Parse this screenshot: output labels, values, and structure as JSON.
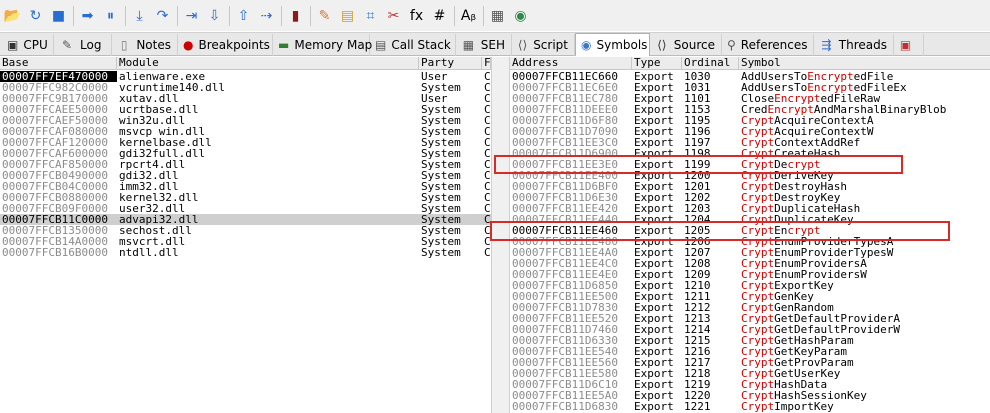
{
  "toolbar": {
    "buttons": [
      {
        "name": "open-icon",
        "glyph": "📂",
        "color": "#d8a437"
      },
      {
        "name": "restart-icon",
        "glyph": "↻",
        "color": "#2a6dd1"
      },
      {
        "name": "stop-icon",
        "glyph": "■",
        "color": "#2a6dd1"
      },
      {
        "name": "sep"
      },
      {
        "name": "run-icon",
        "glyph": "➡",
        "color": "#2a6dd1"
      },
      {
        "name": "pause-icon",
        "glyph": "⏸",
        "color": "#2a6dd1"
      },
      {
        "name": "sep"
      },
      {
        "name": "step-into-icon",
        "glyph": "⤓",
        "color": "#2a6dd1"
      },
      {
        "name": "step-over-icon",
        "glyph": "↷",
        "color": "#2a6dd1"
      },
      {
        "name": "sep"
      },
      {
        "name": "trace-into-icon",
        "glyph": "⇥",
        "color": "#2a6dd1"
      },
      {
        "name": "trace-over-icon",
        "glyph": "⇩",
        "color": "#2a6dd1"
      },
      {
        "name": "sep"
      },
      {
        "name": "execute-till-return-icon",
        "glyph": "⇧",
        "color": "#2a6dd1"
      },
      {
        "name": "run-to-user-code-icon",
        "glyph": "⇢",
        "color": "#2a6dd1"
      },
      {
        "name": "sep"
      },
      {
        "name": "scylla-icon",
        "glyph": "▮",
        "color": "#8a1a1a"
      },
      {
        "name": "sep"
      },
      {
        "name": "patches-icon",
        "glyph": "✎",
        "color": "#d87a3a"
      },
      {
        "name": "comments-icon",
        "glyph": "▤",
        "color": "#c9a227"
      },
      {
        "name": "labels-icon",
        "glyph": "⌗",
        "color": "#3a78c8"
      },
      {
        "name": "bookmarks-icon",
        "glyph": "✂",
        "color": "#c03030"
      },
      {
        "name": "functions-icon",
        "glyph": "fx",
        "color": "#000000"
      },
      {
        "name": "variables-icon",
        "glyph": "#",
        "color": "#000000"
      },
      {
        "name": "sep"
      },
      {
        "name": "strings-icon",
        "glyph": "Aᵦ",
        "color": "#000000"
      },
      {
        "name": "sep"
      },
      {
        "name": "calculator-icon",
        "glyph": "▦",
        "color": "#555555"
      },
      {
        "name": "help-icon",
        "glyph": "◉",
        "color": "#2d8a4a"
      }
    ]
  },
  "tabs": [
    {
      "key": "cpu",
      "label": "CPU",
      "icon": "cpu-icon",
      "glyph": "▣",
      "color": "#333333",
      "width": 52
    },
    {
      "key": "log",
      "label": "Log",
      "icon": "log-icon",
      "glyph": "✎",
      "color": "#555555",
      "width": 58
    },
    {
      "key": "notes",
      "label": "Notes",
      "icon": "notes-icon",
      "glyph": "▯",
      "color": "#777777",
      "width": 66
    },
    {
      "key": "breakpoints",
      "label": "Breakpoints",
      "icon": "breakpoint-icon",
      "glyph": "●",
      "color": "#cc0000",
      "width": 95
    },
    {
      "key": "memory-map",
      "label": "Memory Map",
      "icon": "memory-map-icon",
      "glyph": "▬",
      "color": "#2f7f2f",
      "width": 97
    },
    {
      "key": "call-stack",
      "label": "Call Stack",
      "icon": "call-stack-icon",
      "glyph": "▤",
      "color": "#555555",
      "width": 86
    },
    {
      "key": "seh",
      "label": "SEH",
      "icon": "seh-icon",
      "glyph": "▦",
      "color": "#555555",
      "width": 56
    },
    {
      "key": "script",
      "label": "Script",
      "icon": "script-icon",
      "glyph": "⟨⟩",
      "color": "#555555",
      "width": 63
    },
    {
      "key": "symbols",
      "label": "Symbols",
      "icon": "symbols-icon",
      "glyph": "◉",
      "color": "#3a78c8",
      "width": 75,
      "active": true
    },
    {
      "key": "source",
      "label": "Source",
      "icon": "source-icon",
      "glyph": "⟨⟩",
      "color": "#333333",
      "width": 72
    },
    {
      "key": "references",
      "label": "References",
      "icon": "references-icon",
      "glyph": "⚲",
      "color": "#555555",
      "width": 92
    },
    {
      "key": "threads",
      "label": "Threads",
      "icon": "threads-icon",
      "glyph": "⇶",
      "color": "#2a6dd1",
      "width": 80
    },
    {
      "key": "extra",
      "label": "",
      "icon": "handles-icon",
      "glyph": "▣",
      "color": "#c03030",
      "width": 30
    }
  ],
  "modules": {
    "columns": {
      "base": "Base",
      "module": "Module",
      "party": "Party",
      "path": "F"
    },
    "rows": [
      {
        "base": "00007FF7EF470000",
        "module": "alienware.exe",
        "party": "User",
        "path": "C",
        "selected": true
      },
      {
        "base": "00007FFC982C0000",
        "module": "vcruntime140.dll",
        "party": "System",
        "path": "C"
      },
      {
        "base": "00007FFC9B170000",
        "module": "xutav.dll",
        "party": "User",
        "path": "C"
      },
      {
        "base": "00007FFCAEE50000",
        "module": "ucrtbase.dll",
        "party": "System",
        "path": "C"
      },
      {
        "base": "00007FFCAEF50000",
        "module": "win32u.dll",
        "party": "System",
        "path": "C"
      },
      {
        "base": "00007FFCAF080000",
        "module": "msvcp_win.dll",
        "party": "System",
        "path": "C"
      },
      {
        "base": "00007FFCAF120000",
        "module": "kernelbase.dll",
        "party": "System",
        "path": "C"
      },
      {
        "base": "00007FFCAF600000",
        "module": "gdi32full.dll",
        "party": "System",
        "path": "C"
      },
      {
        "base": "00007FFCAF850000",
        "module": "rpcrt4.dll",
        "party": "System",
        "path": "C"
      },
      {
        "base": "00007FFCB0490000",
        "module": "gdi32.dll",
        "party": "System",
        "path": "C"
      },
      {
        "base": "00007FFCB04C0000",
        "module": "imm32.dll",
        "party": "System",
        "path": "C"
      },
      {
        "base": "00007FFCB0880000",
        "module": "kernel32.dll",
        "party": "System",
        "path": "C"
      },
      {
        "base": "00007FFCB09F0000",
        "module": "user32.dll",
        "party": "System",
        "path": "C"
      },
      {
        "base": "00007FFCB11C0000",
        "module": "advapi32.dll",
        "party": "System",
        "path": "C",
        "highlight": true
      },
      {
        "base": "00007FFCB1350000",
        "module": "sechost.dll",
        "party": "System",
        "path": "C"
      },
      {
        "base": "00007FFCB14A0000",
        "module": "msvcrt.dll",
        "party": "System",
        "path": "C"
      },
      {
        "base": "00007FFCB16B0000",
        "module": "ntdll.dll",
        "party": "System",
        "path": "C"
      }
    ]
  },
  "symbols": {
    "columns": {
      "address": "Address",
      "type": "Type",
      "ordinal": "Ordinal",
      "symbol": "Symbol"
    },
    "rows": [
      {
        "address": "00007FFCB11EC660",
        "type": "Export",
        "ordinal": "1030",
        "parts": [
          [
            "AddUsersTo",
            false
          ],
          [
            "Encrypt",
            true
          ],
          [
            "edFile",
            false
          ]
        ],
        "addr_black": true
      },
      {
        "address": "00007FFCB11EC6E0",
        "type": "Export",
        "ordinal": "1031",
        "parts": [
          [
            "AddUsersTo",
            false
          ],
          [
            "Encrypt",
            true
          ],
          [
            "edFileEx",
            false
          ]
        ]
      },
      {
        "address": "00007FFCB11EC780",
        "type": "Export",
        "ordinal": "1101",
        "parts": [
          [
            "Close",
            false
          ],
          [
            "Encrypt",
            true
          ],
          [
            "edFileRaw",
            false
          ]
        ]
      },
      {
        "address": "00007FFCB11DEEE0",
        "type": "Export",
        "ordinal": "1153",
        "parts": [
          [
            "Cred",
            false
          ],
          [
            "Encrypt",
            true
          ],
          [
            "AndMarshalBinaryBlob",
            false
          ]
        ]
      },
      {
        "address": "00007FFCB11D6F80",
        "type": "Export",
        "ordinal": "1195",
        "parts": [
          [
            "Crypt",
            true
          ],
          [
            "AcquireContextA",
            false
          ]
        ]
      },
      {
        "address": "00007FFCB11D7090",
        "type": "Export",
        "ordinal": "1196",
        "parts": [
          [
            "Crypt",
            true
          ],
          [
            "AcquireContextW",
            false
          ]
        ]
      },
      {
        "address": "00007FFCB11EE3C0",
        "type": "Export",
        "ordinal": "1197",
        "parts": [
          [
            "Crypt",
            true
          ],
          [
            "ContextAddRef",
            false
          ]
        ]
      },
      {
        "address": "00007FFCB11D6900",
        "type": "Export",
        "ordinal": "1198",
        "parts": [
          [
            "Crypt",
            true
          ],
          [
            "CreateHash",
            false
          ]
        ]
      },
      {
        "address": "00007FFCB11EE3E0",
        "type": "Export",
        "ordinal": "1199",
        "parts": [
          [
            "Crypt",
            true
          ],
          [
            "De",
            false
          ],
          [
            "crypt",
            true
          ]
        ]
      },
      {
        "address": "00007FFCB11EE400",
        "type": "Export",
        "ordinal": "1200",
        "parts": [
          [
            "Crypt",
            true
          ],
          [
            "DeriveKey",
            false
          ]
        ]
      },
      {
        "address": "00007FFCB11D6BF0",
        "type": "Export",
        "ordinal": "1201",
        "parts": [
          [
            "Crypt",
            true
          ],
          [
            "DestroyHash",
            false
          ]
        ]
      },
      {
        "address": "00007FFCB11D6E30",
        "type": "Export",
        "ordinal": "1202",
        "parts": [
          [
            "Crypt",
            true
          ],
          [
            "DestroyKey",
            false
          ]
        ]
      },
      {
        "address": "00007FFCB11EE420",
        "type": "Export",
        "ordinal": "1203",
        "parts": [
          [
            "Crypt",
            true
          ],
          [
            "DuplicateHash",
            false
          ]
        ]
      },
      {
        "address": "00007FFCB11EE440",
        "type": "Export",
        "ordinal": "1204",
        "parts": [
          [
            "Crypt",
            true
          ],
          [
            "DuplicateKey",
            false
          ]
        ]
      },
      {
        "address": "00007FFCB11EE460",
        "type": "Export",
        "ordinal": "1205",
        "parts": [
          [
            "Crypt",
            true
          ],
          [
            "En",
            false
          ],
          [
            "crypt",
            true
          ]
        ],
        "addr_black": true
      },
      {
        "address": "00007FFCB11EE480",
        "type": "Export",
        "ordinal": "1206",
        "parts": [
          [
            "Crypt",
            true
          ],
          [
            "EnumProviderTypesA",
            false
          ]
        ]
      },
      {
        "address": "00007FFCB11EE4A0",
        "type": "Export",
        "ordinal": "1207",
        "parts": [
          [
            "Crypt",
            true
          ],
          [
            "EnumProviderTypesW",
            false
          ]
        ]
      },
      {
        "address": "00007FFCB11EE4C0",
        "type": "Export",
        "ordinal": "1208",
        "parts": [
          [
            "Crypt",
            true
          ],
          [
            "EnumProvidersA",
            false
          ]
        ]
      },
      {
        "address": "00007FFCB11EE4E0",
        "type": "Export",
        "ordinal": "1209",
        "parts": [
          [
            "Crypt",
            true
          ],
          [
            "EnumProvidersW",
            false
          ]
        ]
      },
      {
        "address": "00007FFCB11D6850",
        "type": "Export",
        "ordinal": "1210",
        "parts": [
          [
            "Crypt",
            true
          ],
          [
            "ExportKey",
            false
          ]
        ]
      },
      {
        "address": "00007FFCB11EE500",
        "type": "Export",
        "ordinal": "1211",
        "parts": [
          [
            "Crypt",
            true
          ],
          [
            "GenKey",
            false
          ]
        ]
      },
      {
        "address": "00007FFCB11D7830",
        "type": "Export",
        "ordinal": "1212",
        "parts": [
          [
            "Crypt",
            true
          ],
          [
            "GenRandom",
            false
          ]
        ]
      },
      {
        "address": "00007FFCB11EE520",
        "type": "Export",
        "ordinal": "1213",
        "parts": [
          [
            "Crypt",
            true
          ],
          [
            "GetDefaultProviderA",
            false
          ]
        ]
      },
      {
        "address": "00007FFCB11D7460",
        "type": "Export",
        "ordinal": "1214",
        "parts": [
          [
            "Crypt",
            true
          ],
          [
            "GetDefaultProviderW",
            false
          ]
        ]
      },
      {
        "address": "00007FFCB11D6330",
        "type": "Export",
        "ordinal": "1215",
        "parts": [
          [
            "Crypt",
            true
          ],
          [
            "GetHashParam",
            false
          ]
        ]
      },
      {
        "address": "00007FFCB11EE540",
        "type": "Export",
        "ordinal": "1216",
        "parts": [
          [
            "Crypt",
            true
          ],
          [
            "GetKeyParam",
            false
          ]
        ]
      },
      {
        "address": "00007FFCB11EE560",
        "type": "Export",
        "ordinal": "1217",
        "parts": [
          [
            "Crypt",
            true
          ],
          [
            "GetProvParam",
            false
          ]
        ]
      },
      {
        "address": "00007FFCB11EE580",
        "type": "Export",
        "ordinal": "1218",
        "parts": [
          [
            "Crypt",
            true
          ],
          [
            "GetUserKey",
            false
          ]
        ]
      },
      {
        "address": "00007FFCB11D6C10",
        "type": "Export",
        "ordinal": "1219",
        "parts": [
          [
            "Crypt",
            true
          ],
          [
            "HashData",
            false
          ]
        ]
      },
      {
        "address": "00007FFCB11EE5A0",
        "type": "Export",
        "ordinal": "1220",
        "parts": [
          [
            "Crypt",
            true
          ],
          [
            "HashSessionKey",
            false
          ]
        ]
      },
      {
        "address": "00007FFCB11D6830",
        "type": "Export",
        "ordinal": "1221",
        "parts": [
          [
            "Crypt",
            true
          ],
          [
            "ImportKey",
            false
          ]
        ]
      }
    ]
  },
  "annotations": {
    "color": "#d62b2b"
  }
}
